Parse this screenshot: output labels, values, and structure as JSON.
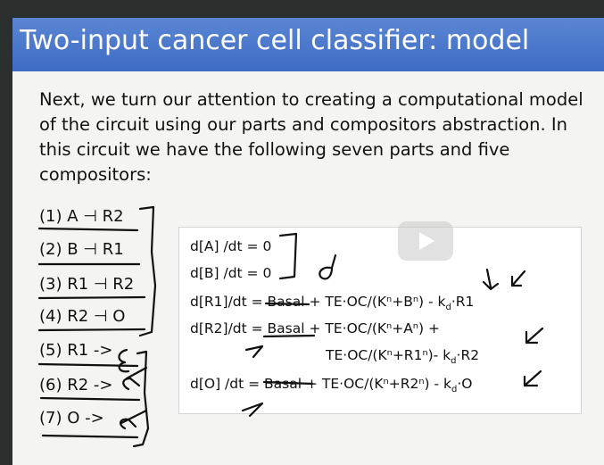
{
  "slide": {
    "title": "Two-input cancer cell classifier: model",
    "paragraph": "Next, we turn our attention to creating a computational model of the circuit using our parts and compositors abstraction.  In this circuit we have the following seven parts and five compositors:"
  },
  "parts": [
    "(1) A ⊣ R2",
    "(2) B ⊣ R1",
    "(3) R1 ⊣ R2",
    "(4) R2 ⊣ O",
    "(5) R1 ->",
    "(6) R2 ->",
    "(7) O ->"
  ],
  "equations": [
    "d[A] /dt = 0",
    "d[B] /dt = 0",
    "d[R1]/dt = Basal + TE·OC/(Kⁿ+Bⁿ)  - k_d·R1",
    "d[R2]/dt = Basal + TE·OC/(Kⁿ+Aⁿ)  +",
    "TE·OC/(Kⁿ+R1ⁿ)- k_d·R2",
    "d[O] /dt = Basal + TE·OC/(Kⁿ+R2ⁿ) - k_d·O"
  ],
  "video": {
    "icon": "play-icon"
  }
}
